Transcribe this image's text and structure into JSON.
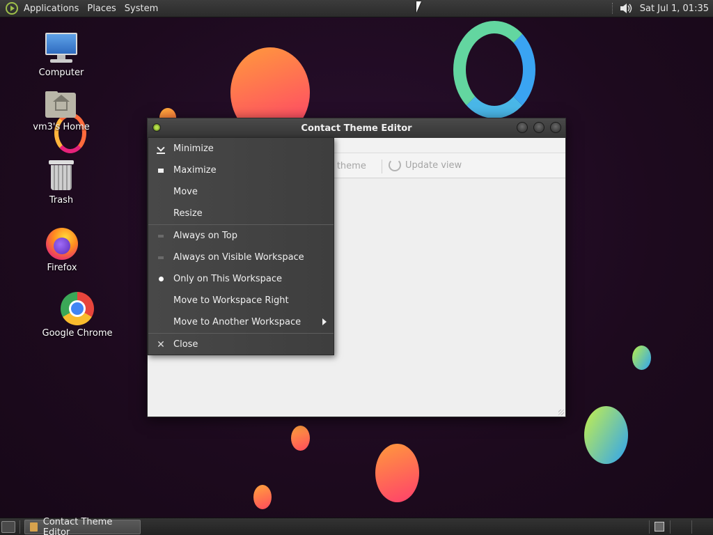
{
  "top_panel": {
    "menus": [
      "Applications",
      "Places",
      "System"
    ],
    "clock": "Sat Jul  1, 01:35",
    "icons": [
      "distro-logo-icon",
      "volume-icon"
    ]
  },
  "desktop_icons": [
    {
      "label": "Computer",
      "icon": "computer-icon"
    },
    {
      "label": "vm3's Home",
      "icon": "home-folder-icon"
    },
    {
      "label": "Trash",
      "icon": "trash-icon"
    },
    {
      "label": "Firefox",
      "icon": "firefox-icon"
    },
    {
      "label": "Google Chrome",
      "icon": "chrome-icon"
    }
  ],
  "window": {
    "title": "Contact Theme Editor",
    "toolbar": {
      "save_label": "ve theme",
      "update_label": "Update view"
    }
  },
  "context_menu": {
    "items": [
      {
        "label": "Minimize",
        "mark": "minimize-icon"
      },
      {
        "label": "Maximize",
        "mark": "maximize-icon"
      },
      {
        "label": "Move",
        "mark": ""
      },
      {
        "label": "Resize",
        "mark": ""
      },
      {
        "label": "Always on Top",
        "mark": "unchecked-icon"
      },
      {
        "label": "Always on Visible Workspace",
        "mark": "unchecked-icon"
      },
      {
        "label": "Only on This Workspace",
        "mark": "radio-selected-icon"
      },
      {
        "label": "Move to Workspace Right",
        "mark": ""
      },
      {
        "label": "Move to Another Workspace",
        "mark": "submenu-arrow-icon"
      },
      {
        "label": "Close",
        "mark": "close-icon"
      }
    ]
  },
  "taskbar": {
    "items": [
      {
        "label": "Contact Theme Editor"
      }
    ]
  }
}
